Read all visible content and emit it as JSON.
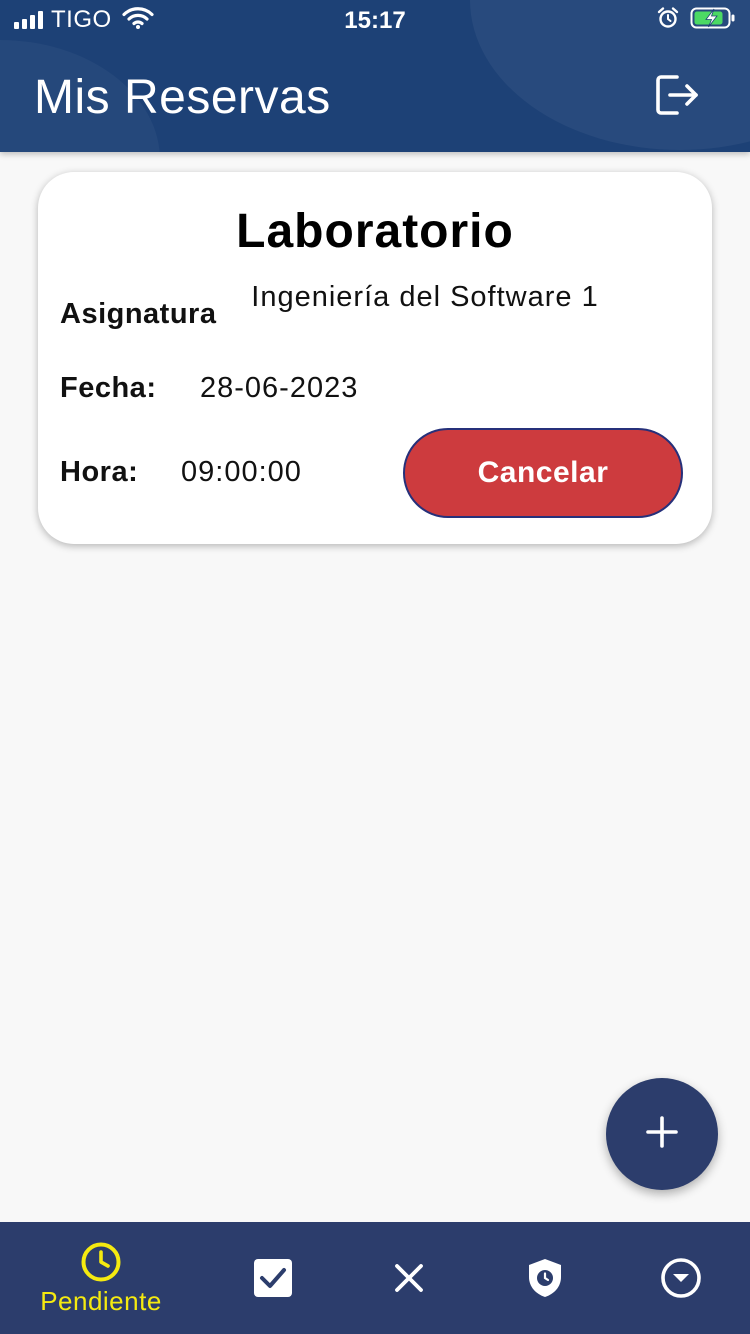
{
  "status_bar": {
    "carrier": "TIGO",
    "time": "15:17"
  },
  "app_bar": {
    "title": "Mis Reservas"
  },
  "reservation_card": {
    "title": "Laboratorio",
    "asignatura_label": "Asignatura",
    "asignatura_value": "Ingeniería del Software 1",
    "fecha_label": "Fecha:",
    "fecha_value": "28-06-2023",
    "hora_label": "Hora:",
    "hora_value": "09:00:00",
    "cancel_label": "Cancelar"
  },
  "bottom_nav": {
    "items": [
      {
        "label": "Pendiente",
        "icon": "clock-icon",
        "active": true
      },
      {
        "label": "",
        "icon": "checkbox-check-icon",
        "active": false
      },
      {
        "label": "",
        "icon": "close-icon",
        "active": false
      },
      {
        "label": "",
        "icon": "shield-clock-icon",
        "active": false
      },
      {
        "label": "",
        "icon": "circle-chevron-down-icon",
        "active": false
      }
    ]
  },
  "colors": {
    "header": "#1d4176",
    "nav_bg": "#2c3d6c",
    "active_nav": "#f5ea10",
    "cancel_button": "#cd3b3e",
    "battery_charge": "#4cd964"
  },
  "icons": {
    "logout": "logout-icon",
    "fab": "plus-icon"
  }
}
